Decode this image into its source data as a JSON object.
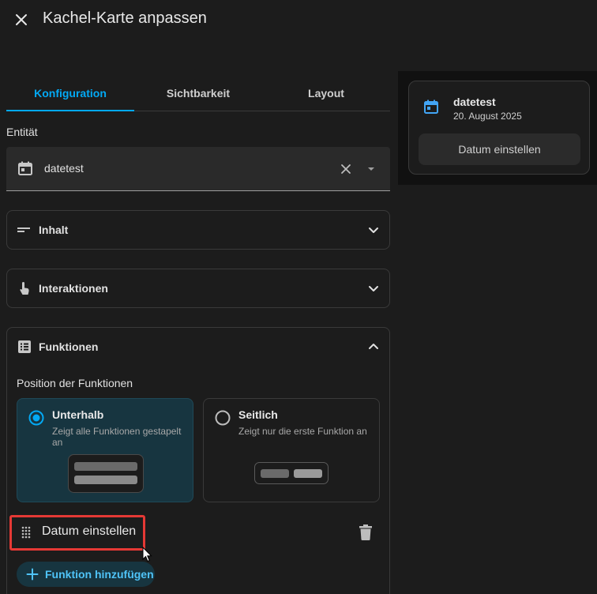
{
  "header": {
    "title": "Kachel-Karte anpassen"
  },
  "tabs": [
    {
      "label": "Konfiguration",
      "active": true
    },
    {
      "label": "Sichtbarkeit",
      "active": false
    },
    {
      "label": "Layout",
      "active": false
    }
  ],
  "entity": {
    "label": "Entität",
    "value": "datetest"
  },
  "sections": {
    "content": {
      "title": "Inhalt"
    },
    "interactions": {
      "title": "Interaktionen"
    },
    "features": {
      "title": "Funktionen"
    }
  },
  "features_position": {
    "label": "Position der Funktionen",
    "options": [
      {
        "title": "Unterhalb",
        "description": "Zeigt alle Funktionen gestapelt an",
        "selected": true
      },
      {
        "title": "Seitlich",
        "description": "Zeigt nur die erste Funktion an",
        "selected": false
      }
    ]
  },
  "feature_item": {
    "label": "Datum einstellen"
  },
  "add_feature": {
    "label": "Funktion hinzufügen"
  },
  "preview": {
    "entity_name": "datetest",
    "state": "20. August 2025",
    "button_label": "Datum einstellen"
  },
  "colors": {
    "accent": "#03a9f4",
    "highlight_border": "#e53935",
    "selected_bg": "#173540"
  },
  "icons": {
    "close": "close-icon",
    "calendar": "calendar-icon",
    "clear": "clear-icon",
    "dropdown": "dropdown-arrow-icon",
    "content": "text-lines-icon",
    "interactions": "gesture-tap-icon",
    "features": "list-box-icon",
    "drag": "drag-handle-icon",
    "delete": "trash-icon",
    "add": "plus-icon"
  }
}
